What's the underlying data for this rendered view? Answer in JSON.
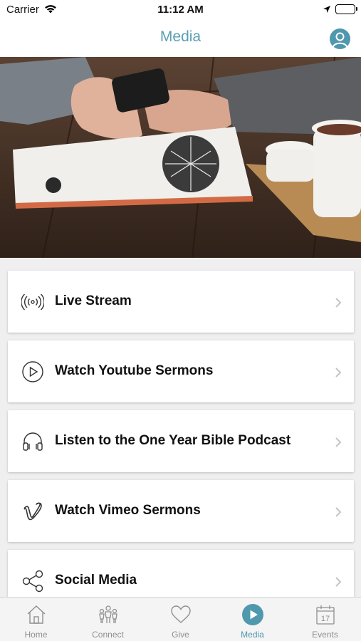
{
  "status_bar": {
    "carrier": "Carrier",
    "time": "11:12 AM"
  },
  "nav": {
    "title": "Media",
    "profile_icon": "user-icon"
  },
  "colors": {
    "accent": "#4f98ad",
    "inactive": "#8f8f8f"
  },
  "list": [
    {
      "label": "Live Stream",
      "icon": "live-stream-icon"
    },
    {
      "label": "Watch Youtube Sermons",
      "icon": "play-circle-icon"
    },
    {
      "label": "Listen to the One Year Bible Podcast",
      "icon": "headphones-icon"
    },
    {
      "label": "Watch Vimeo Sermons",
      "icon": "vimeo-icon"
    },
    {
      "label": "Social Media",
      "icon": "share-icon"
    }
  ],
  "tabs": [
    {
      "label": "Home",
      "icon": "home-icon",
      "active": false
    },
    {
      "label": "Connect",
      "icon": "people-icon",
      "active": false
    },
    {
      "label": "Give",
      "icon": "heart-icon",
      "active": false
    },
    {
      "label": "Media",
      "icon": "play-circle-icon",
      "active": true
    },
    {
      "label": "Events",
      "icon": "calendar-icon",
      "active": false
    }
  ]
}
